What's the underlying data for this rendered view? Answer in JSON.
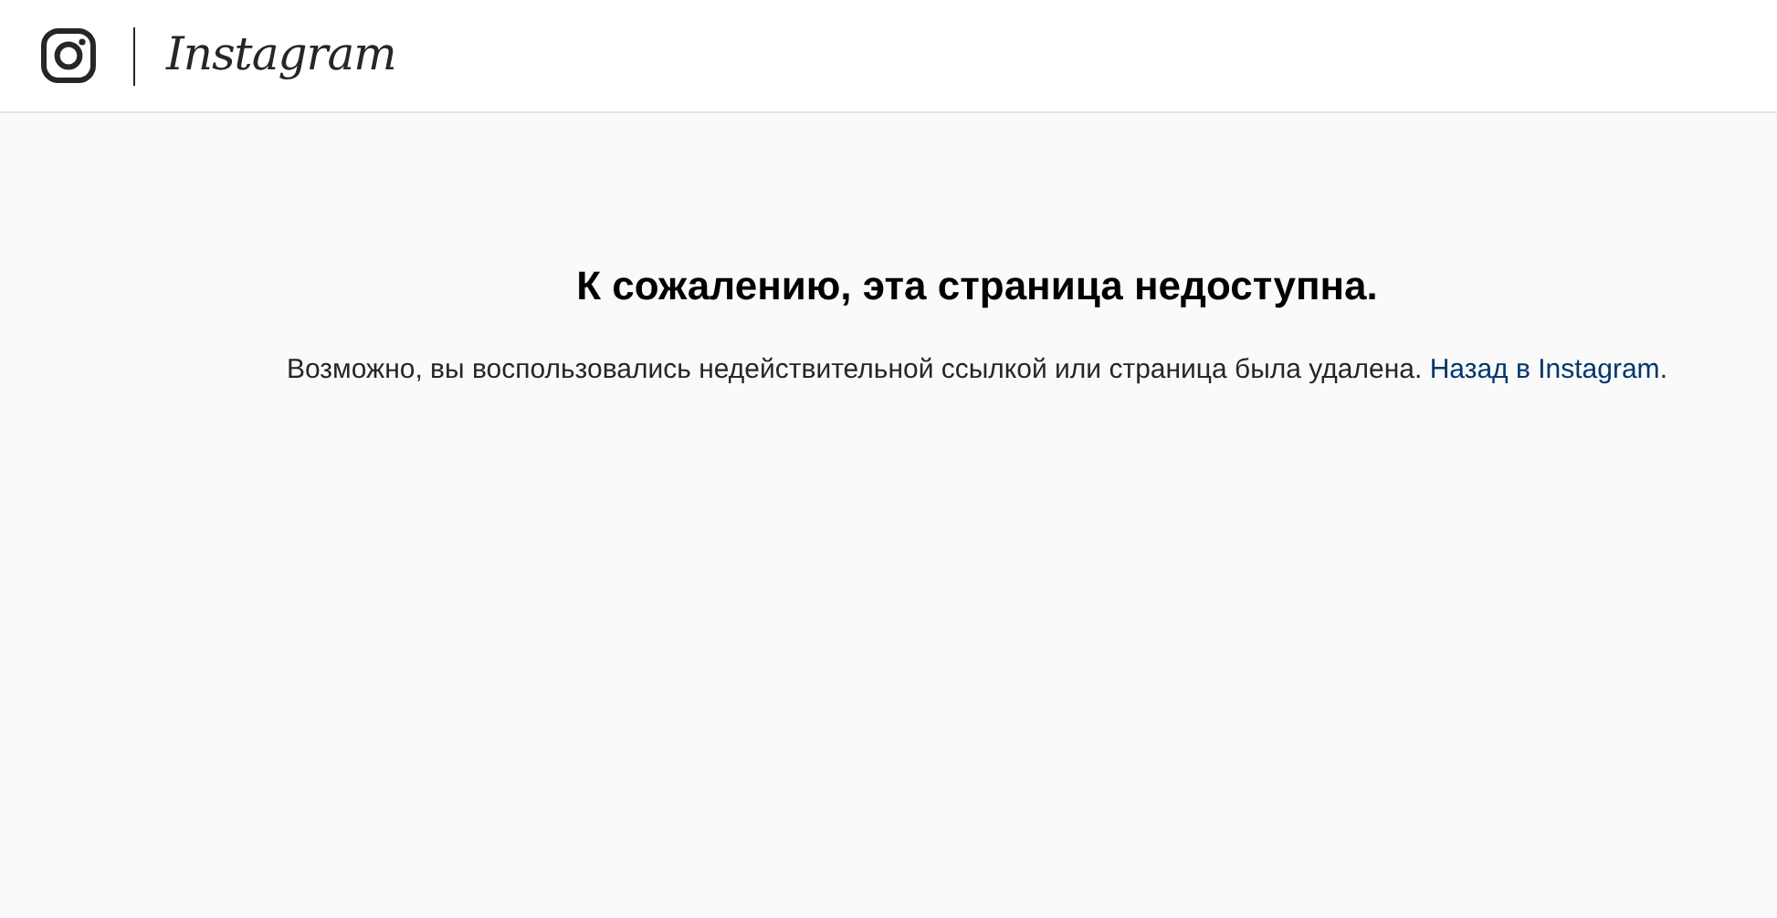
{
  "header": {
    "logo_text": "Instagram"
  },
  "error": {
    "title": "К сожалению, эта страница недоступна.",
    "message": "Возможно, вы воспользовались недействительной ссылкой или страница была удалена.",
    "link": "Назад в Instagram",
    "after_link": "."
  }
}
